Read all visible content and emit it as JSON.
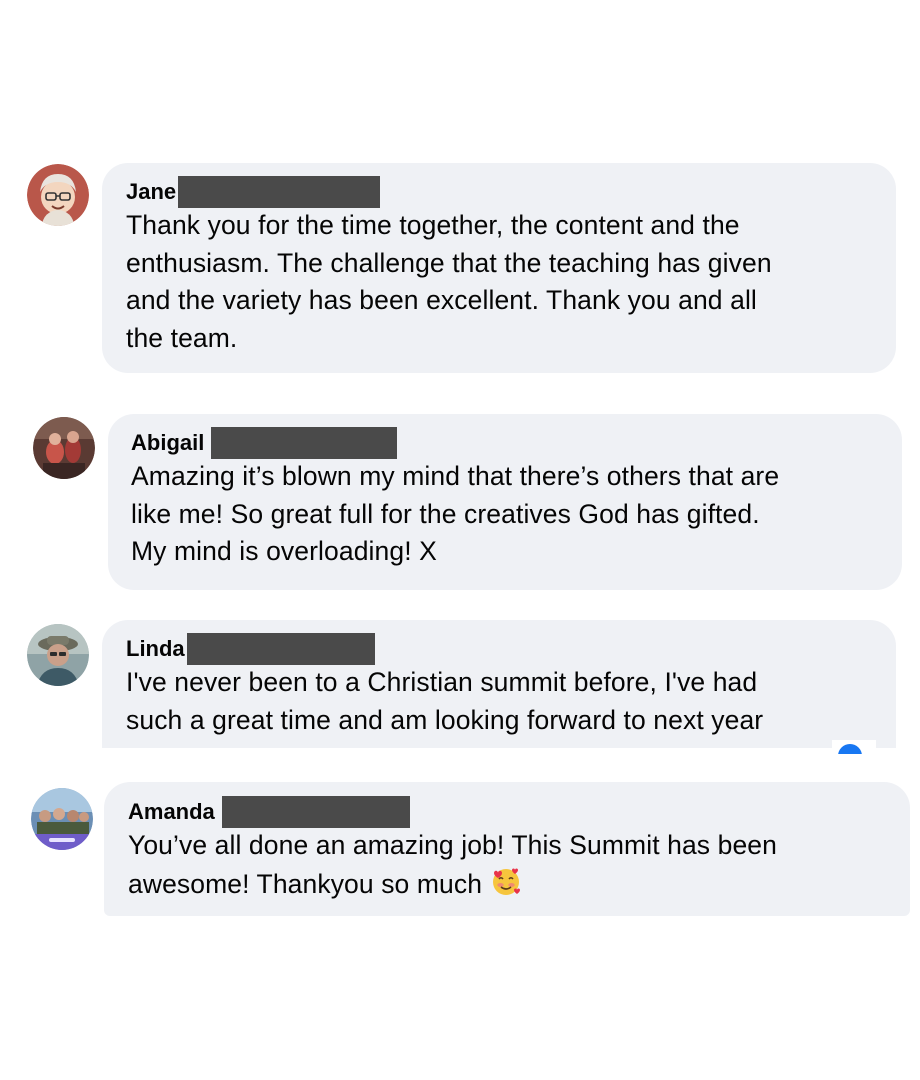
{
  "comments": [
    {
      "author": "Jane",
      "text": "Thank you for the time together, the content and the\nenthusiasm. The challenge that the teaching has given\nand the variety has been excellent. Thank you and all\nthe team."
    },
    {
      "author": "Abigail",
      "text": "Amazing it’s blown my mind that there’s others that are\nlike me! So great full for the creatives God has gifted.\nMy mind is overloading! X"
    },
    {
      "author": "Linda",
      "text": "I've never been to a Christian summit before, I've had\nsuch a great time and am looking forward to next year"
    },
    {
      "author": "Amanda",
      "text": "You’ve all done an amazing job! This Summit has been\nawesome! Thankyou so much"
    }
  ],
  "emoji": "smiling-face-with-hearts-icon",
  "colors": {
    "bubble": "#eff1f5",
    "redaction": "#4a4a4a",
    "text": "#050505",
    "reaction_blue": "#1877f2"
  }
}
